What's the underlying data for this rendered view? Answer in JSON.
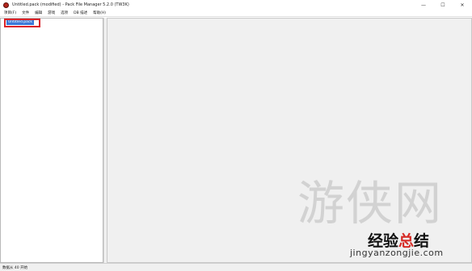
{
  "window": {
    "title": "Untitled.pack (modified) - Pack File Manager 5.2.0 (TW3K)",
    "icon": "app-icon",
    "controls": {
      "minimize": "—",
      "maximize": "☐",
      "close": "✕"
    }
  },
  "menubar": {
    "items": [
      "项目(F)",
      "文件",
      "编辑",
      "游戏",
      "选项",
      "DB 描述",
      "帮助(H)"
    ]
  },
  "tree": {
    "selected_node": "Untitled.pack",
    "highlight_color": "#d9232a",
    "selection_color": "#3b78d8"
  },
  "watermark": {
    "glyphs": "游侠网",
    "brand_part1": "经验",
    "brand_part2": "总",
    "brand_part3": "结",
    "url": "jingyanzongjie.com"
  },
  "statusbar": {
    "text": "数据从 40 开始"
  }
}
